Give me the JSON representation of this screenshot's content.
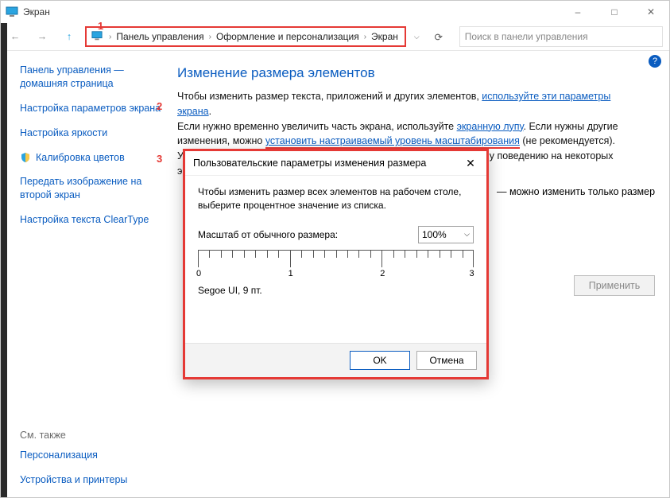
{
  "window": {
    "title": "Экран",
    "minimize": "–",
    "maximize": "□",
    "close": "✕"
  },
  "toolbar": {
    "back": "←",
    "forward": "→",
    "up": "↑",
    "breadcrumbs": [
      "Панель управления",
      "Оформление и персонализация",
      "Экран"
    ],
    "dropdown": "⌵",
    "refresh": "⟳",
    "search_placeholder": "Поиск в панели управления"
  },
  "annotations": {
    "one": "1",
    "two": "2",
    "three": "3"
  },
  "sidebar": {
    "home": "Панель управления — домашняя страница",
    "links": [
      "Настройка параметров экрана",
      "Настройка яркости",
      "Калибровка цветов",
      "Передать изображение на второй экран",
      "Настройка текста ClearType"
    ],
    "see_also": "См. также",
    "see_links": [
      "Персонализация",
      "Устройства и принтеры"
    ]
  },
  "content": {
    "heading": "Изменение размера элементов",
    "p1_a": "Чтобы изменить размер текста, приложений и других элементов, ",
    "p1_link": "используйте эти параметры экрана",
    "p1_b": ".",
    "p2_a": "Если нужно временно увеличить часть экрана, используйте ",
    "p2_link1": "экранную лупу",
    "p2_b": ". Если нужны другие изменения, можно ",
    "p2_link2": "установить настраиваемый уровень масштабирования",
    "p2_c": " (не рекомендуется).",
    "p3": "Установка настраиваемых уровней может привести к неожиданному поведению на некоторых экранах.",
    "side_note": "— можно изменить только размер",
    "apply": "Применить"
  },
  "dialog": {
    "title": "Пользовательские параметры изменения размера",
    "close": "✕",
    "text": "Чтобы изменить размер всех элементов на рабочем столе, выберите процентное значение из списка.",
    "scale_label": "Масштаб от обычного размера:",
    "scale_value": "100%",
    "ruler": [
      "0",
      "1",
      "2",
      "3"
    ],
    "sample": "Segoe UI, 9 пт.",
    "ok": "OK",
    "cancel": "Отмена"
  },
  "help": "?"
}
